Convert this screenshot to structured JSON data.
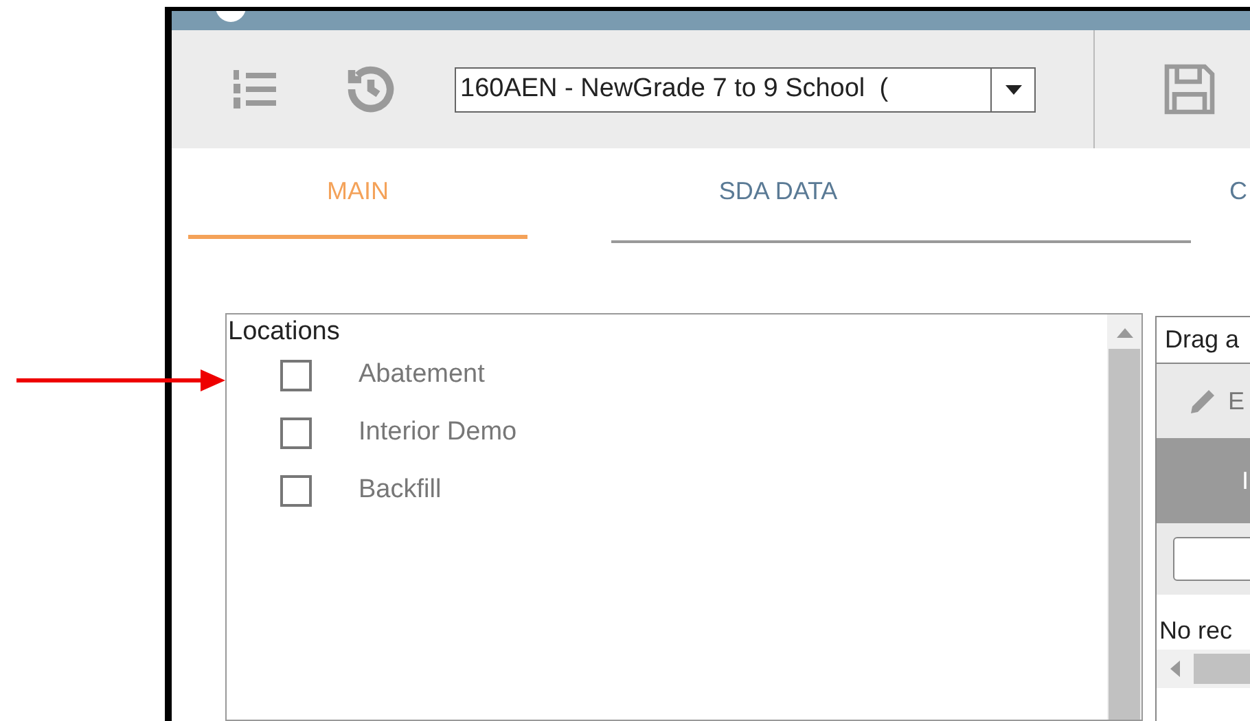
{
  "toolbar": {
    "record_select": {
      "value": "160AEN - NewGrade 7 to 9 School  ("
    }
  },
  "tabs": [
    {
      "label": "MAIN",
      "selected": true
    },
    {
      "label": "SDA DATA",
      "selected": false
    },
    {
      "label": "C",
      "selected": false
    }
  ],
  "locations": {
    "title": "Locations",
    "items": [
      {
        "label": "Abatement",
        "checked": false
      },
      {
        "label": "Interior Demo",
        "checked": false
      },
      {
        "label": "Backfill",
        "checked": false
      }
    ]
  },
  "grid": {
    "group_hint": "Drag a",
    "edit_button": "E",
    "column_header": "I",
    "empty_message": "No rec"
  }
}
